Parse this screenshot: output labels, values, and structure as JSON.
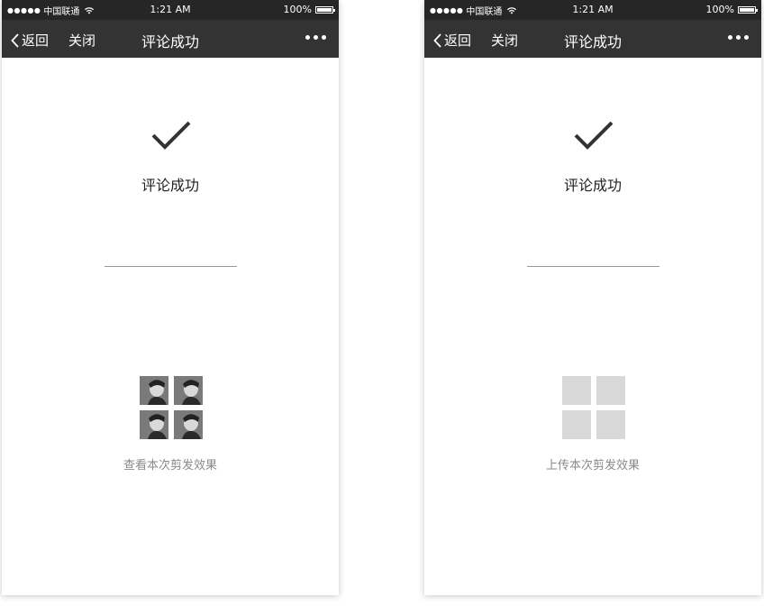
{
  "screens": [
    {
      "status_bar": {
        "carrier": "中国联通",
        "time": "1:21 AM",
        "battery": "100%",
        "battery_level": 1.0
      },
      "nav": {
        "back": "返回",
        "close": "关闭",
        "title": "评论成功"
      },
      "success_text": "评论成功",
      "action": {
        "label": "查看本次剪发效果",
        "icon": "photo-grid-icon"
      }
    },
    {
      "status_bar": {
        "carrier": "中国联通",
        "time": "1:21 AM",
        "battery": "100%",
        "battery_level": 1.0
      },
      "nav": {
        "back": "返回",
        "close": "关闭",
        "title": "评论成功"
      },
      "success_text": "评论成功",
      "action": {
        "label": "上传本次剪发效果",
        "icon": "upload-grid-placeholder-icon"
      }
    }
  ],
  "colors": {
    "navbar": "#333333",
    "statusbar": "#262626",
    "placeholder": "#d8d8d8",
    "caption": "#8a8a8a"
  }
}
